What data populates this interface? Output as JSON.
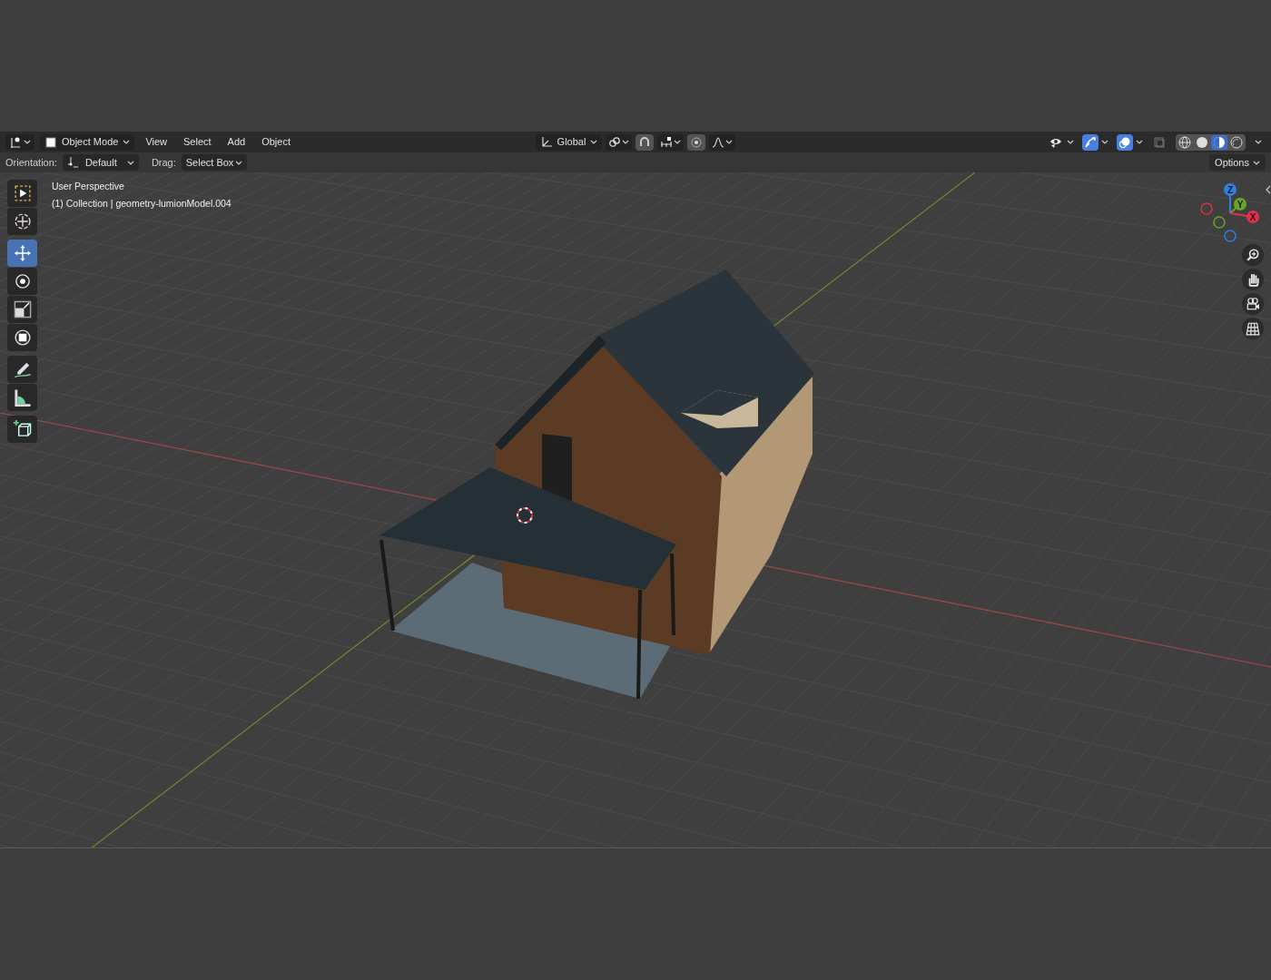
{
  "header": {
    "mode": "Object Mode",
    "menus": [
      "View",
      "Select",
      "Add",
      "Object"
    ],
    "orientation": "Global",
    "center_tools": [
      {
        "kind": "pivot",
        "on": false
      },
      {
        "kind": "snap",
        "on": true
      },
      {
        "kind": "snap_target",
        "on": false
      },
      {
        "kind": "proportional",
        "on": true
      },
      {
        "kind": "falloff",
        "on": false
      }
    ],
    "right_toggles": [
      {
        "kind": "visibility",
        "on": false
      },
      {
        "kind": "gizmo",
        "on": true
      },
      {
        "kind": "overlay",
        "on": true
      },
      {
        "kind": "xray",
        "on": false
      }
    ],
    "shading": [
      {
        "kind": "wireframe",
        "selected": false
      },
      {
        "kind": "solid",
        "selected": false
      },
      {
        "kind": "material",
        "selected": true
      },
      {
        "kind": "rendered",
        "selected": false
      }
    ]
  },
  "tool_settings": {
    "orientation_label": "Orientation:",
    "orientation": "Default",
    "drag_label": "Drag:",
    "drag": "Select Box",
    "options": "Options"
  },
  "viewport": {
    "view_name": "User Perspective",
    "object_info": "(1) Collection | geometry-lumionModel.004",
    "tool_groups": [
      [
        {
          "kind": "select_box",
          "selected": false
        },
        {
          "kind": "cursor",
          "selected": false
        }
      ],
      [
        {
          "kind": "move",
          "selected": true
        },
        {
          "kind": "rotate",
          "selected": false
        },
        {
          "kind": "scale",
          "selected": false
        },
        {
          "kind": "transform",
          "selected": false
        }
      ],
      [
        {
          "kind": "annotate",
          "selected": false
        },
        {
          "kind": "measure",
          "selected": false
        }
      ],
      [
        {
          "kind": "add_cube",
          "selected": false
        }
      ]
    ],
    "gizmo_axes": [
      {
        "label": "Z",
        "color": "#2f7fe0"
      },
      {
        "label": "Y",
        "color": "#6aa325"
      },
      {
        "label": "X",
        "color": "#e0304a"
      }
    ],
    "navigation": [
      {
        "kind": "zoom"
      },
      {
        "kind": "pan"
      },
      {
        "kind": "camera"
      },
      {
        "kind": "ortho"
      }
    ]
  }
}
